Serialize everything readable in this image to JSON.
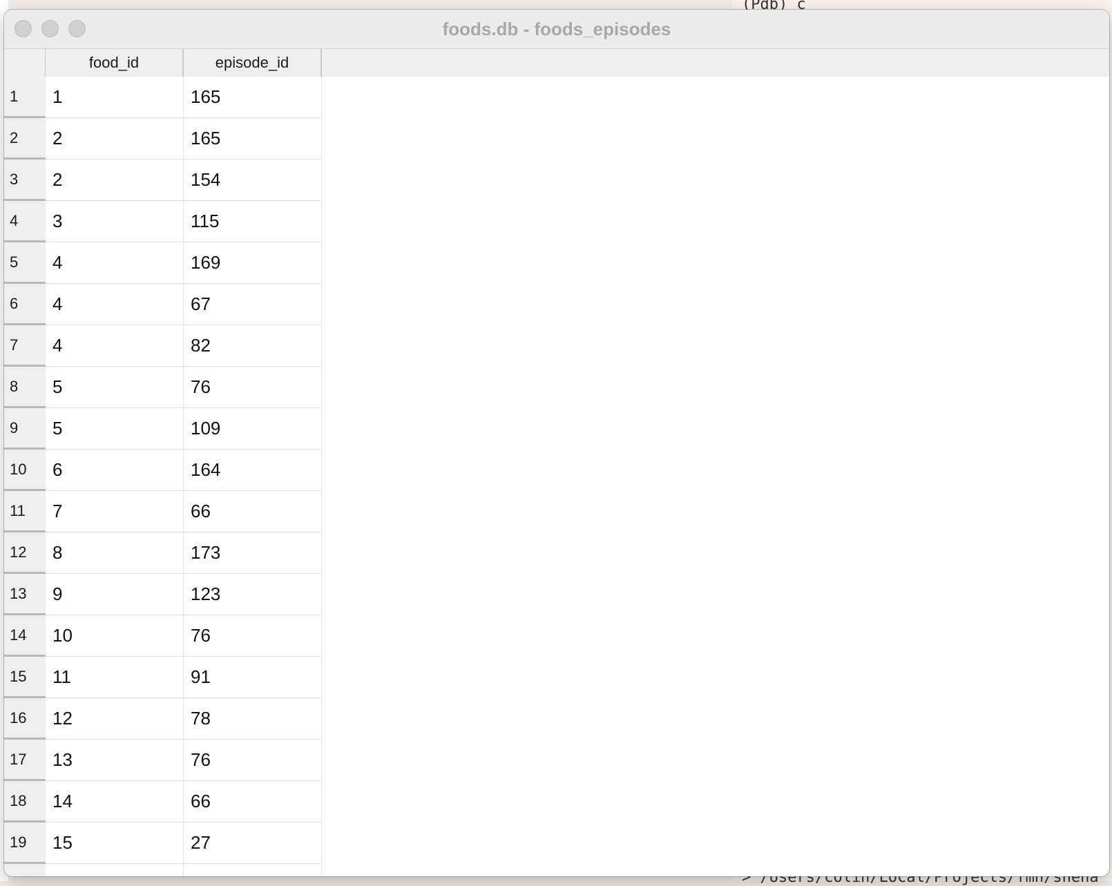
{
  "window": {
    "title": "foods.db - foods_episodes"
  },
  "background": {
    "terminal_top": "(Pdb) c",
    "terminal_bottom": "> /Users/colin/Local/Projects/fmh/sheha"
  },
  "table": {
    "columns": [
      "food_id",
      "episode_id"
    ],
    "rows": [
      {
        "num": "1",
        "food_id": "1",
        "episode_id": "165"
      },
      {
        "num": "2",
        "food_id": "2",
        "episode_id": "165"
      },
      {
        "num": "3",
        "food_id": "2",
        "episode_id": "154"
      },
      {
        "num": "4",
        "food_id": "3",
        "episode_id": "115"
      },
      {
        "num": "5",
        "food_id": "4",
        "episode_id": "169"
      },
      {
        "num": "6",
        "food_id": "4",
        "episode_id": "67"
      },
      {
        "num": "7",
        "food_id": "4",
        "episode_id": "82"
      },
      {
        "num": "8",
        "food_id": "5",
        "episode_id": "76"
      },
      {
        "num": "9",
        "food_id": "5",
        "episode_id": "109"
      },
      {
        "num": "10",
        "food_id": "6",
        "episode_id": "164"
      },
      {
        "num": "11",
        "food_id": "7",
        "episode_id": "66"
      },
      {
        "num": "12",
        "food_id": "8",
        "episode_id": "173"
      },
      {
        "num": "13",
        "food_id": "9",
        "episode_id": "123"
      },
      {
        "num": "14",
        "food_id": "10",
        "episode_id": "76"
      },
      {
        "num": "15",
        "food_id": "11",
        "episode_id": "91"
      },
      {
        "num": "16",
        "food_id": "12",
        "episode_id": "78"
      },
      {
        "num": "17",
        "food_id": "13",
        "episode_id": "76"
      },
      {
        "num": "18",
        "food_id": "14",
        "episode_id": "66"
      },
      {
        "num": "19",
        "food_id": "15",
        "episode_id": "27"
      },
      {
        "num": "",
        "food_id": "",
        "episode_id": ""
      }
    ]
  }
}
